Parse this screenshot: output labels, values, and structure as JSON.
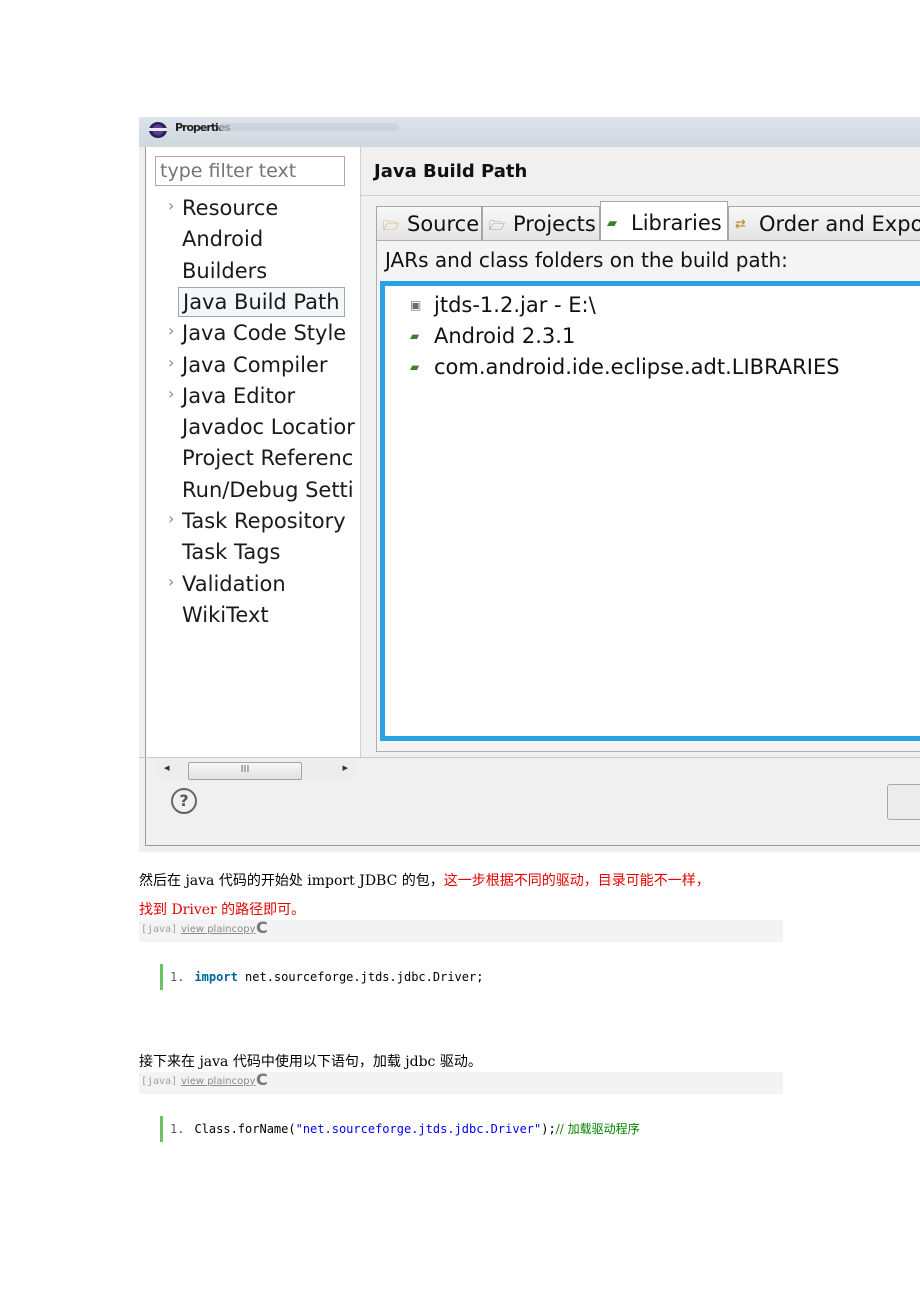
{
  "screenshot": {
    "title": "Properties",
    "filter_placeholder": "type filter text",
    "tree_items": [
      {
        "label": "Resource",
        "expandable": true
      },
      {
        "label": "Android",
        "expandable": false
      },
      {
        "label": "Builders",
        "expandable": false
      },
      {
        "label": "Java Build Path",
        "expandable": false,
        "selected": true
      },
      {
        "label": "Java Code Style",
        "expandable": true
      },
      {
        "label": "Java Compiler",
        "expandable": true
      },
      {
        "label": "Java Editor",
        "expandable": true
      },
      {
        "label": "Javadoc Locatior",
        "expandable": false
      },
      {
        "label": "Project Referenc",
        "expandable": false
      },
      {
        "label": "Run/Debug Setti",
        "expandable": false
      },
      {
        "label": "Task Repository",
        "expandable": true
      },
      {
        "label": "Task Tags",
        "expandable": false
      },
      {
        "label": "Validation",
        "expandable": true
      },
      {
        "label": "WikiText",
        "expandable": false
      }
    ],
    "scrollbar_thumb": "III",
    "page_title": "Java Build Path",
    "tabs": [
      {
        "label": "Source",
        "icon": "source-folder-icon"
      },
      {
        "label": "Projects",
        "icon": "projects-icon"
      },
      {
        "label": "Libraries",
        "icon": "libraries-icon",
        "active": true
      },
      {
        "label": "Order and Expor",
        "icon": "order-export-icon"
      }
    ],
    "jars_label": "JARs and class folders on the build path:",
    "libraries": [
      {
        "label": "jtds-1.2.jar - E:\\",
        "icon": "jar-icon"
      },
      {
        "label": "Android 2.3.1",
        "icon": "library-icon"
      },
      {
        "label": "com.android.ide.eclipse.adt.LIBRARIES",
        "icon": "library-icon"
      }
    ],
    "help": "?"
  },
  "article": {
    "para1_black": "然后在 java 代码的开始处  import JDBC 的包，",
    "para1_red": "这一步根据不同的驱动，目录可能不一样，",
    "para1_line2_red": "找到 Driver 的路径即可。",
    "code_bar_lang": "[java]",
    "code_bar_view": "view plaincopy",
    "code1": {
      "num": "1.",
      "keyword": "import",
      "rest": " net.sourceforge.jtds.jdbc.Driver;"
    },
    "para2": "接下来在 java 代码中使用以下语句，加载 jdbc 驱动。",
    "code2": {
      "num": "1.",
      "pre": "Class.forName(",
      "string": "\"net.sourceforge.jtds.jdbc.Driver\"",
      "post": ");",
      "comment": "// 加载驱动程序"
    }
  }
}
